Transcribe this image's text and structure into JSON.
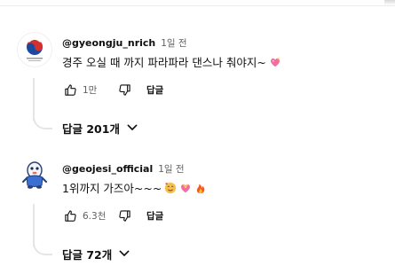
{
  "comments": [
    {
      "handle": "@gyeongju_nrich",
      "time": "1일 전",
      "text": "경주 오실 때 까지 파라파라 댄스나 춰야지~",
      "likes": "1만",
      "reply_label": "답글",
      "replies_label": "답글 201개",
      "emojis": [
        "sparkling-heart"
      ],
      "avatar": "korea-government-emblem"
    },
    {
      "handle": "@geojesi_official",
      "time": "1일 전",
      "text": "1위까지 가즈아~~~",
      "likes": "6.3천",
      "reply_label": "답글",
      "replies_label": "답글 72개",
      "emojis": [
        "smiling-face-with-hearts",
        "heart-with-ribbon",
        "fire"
      ],
      "avatar": "mascot-character"
    }
  ],
  "colors": {
    "text": "#0f0f0f",
    "secondary": "#606060",
    "thread_line": "#e5e5e5",
    "heart": "#f06fa0"
  }
}
